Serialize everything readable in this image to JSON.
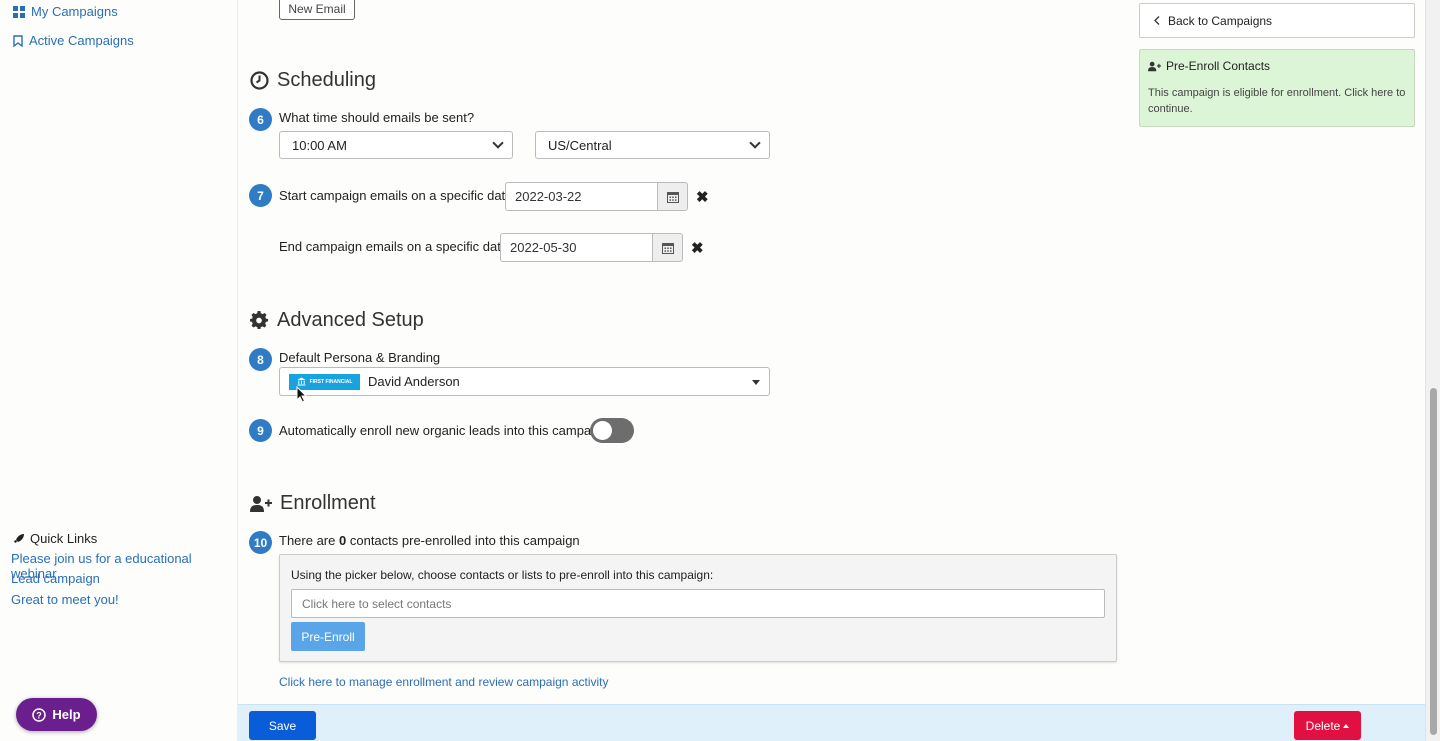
{
  "sidebar": {
    "nav": [
      {
        "label": "My Campaigns",
        "icon": "grid-icon"
      },
      {
        "label": "Active Campaigns",
        "icon": "bookmark-icon"
      }
    ],
    "quick_links_title": "Quick Links",
    "quick_links": [
      "Please join us for a educational webinar",
      "Lead campaign",
      "Great to meet you!"
    ],
    "help_label": "Help"
  },
  "main": {
    "new_email_label": "New Email",
    "scheduling": {
      "title": "Scheduling",
      "step6": {
        "num": "6",
        "label": "What time should emails be sent?",
        "time_value": "10:00 AM",
        "timezone_value": "US/Central"
      },
      "step7": {
        "num": "7",
        "label": "Start campaign emails on a specific date?",
        "value": "2022-03-22"
      },
      "end": {
        "label": "End campaign emails on a specific date?",
        "value": "2022-05-30"
      }
    },
    "advanced": {
      "title": "Advanced Setup",
      "step8": {
        "num": "8",
        "label": "Default Persona & Branding",
        "persona": "David Anderson",
        "logo_text": "FIRST FINANCIAL"
      },
      "step9": {
        "num": "9",
        "label": "Automatically enroll new organic leads into this campaign",
        "enabled": false
      }
    },
    "enrollment": {
      "title": "Enrollment",
      "step10": {
        "num": "10",
        "prefix": "There are",
        "count": "0",
        "suffix": "contacts pre-enrolled into this campaign"
      },
      "picker_instructions": "Using the picker below, choose contacts or lists to pre-enroll into this campaign:",
      "picker_placeholder": "Click here to select contacts",
      "pre_enroll_label": "Pre-Enroll",
      "manage_link": "Click here to manage enrollment and review campaign activity"
    },
    "footer": {
      "save_label": "Save",
      "delete_label": "Delete"
    }
  },
  "right_panel": {
    "back_label": "Back to Campaigns",
    "pre_enroll_title": "Pre-Enroll Contacts",
    "pre_enroll_text": "This campaign is eligible for enrollment. Click here to continue."
  },
  "colors": {
    "link": "#2a6fb5",
    "badge": "#2f7bc4",
    "save": "#0a5dd8",
    "delete": "#e21040",
    "help": "#6b1f8f",
    "panel_green": "#dcf5d6"
  }
}
